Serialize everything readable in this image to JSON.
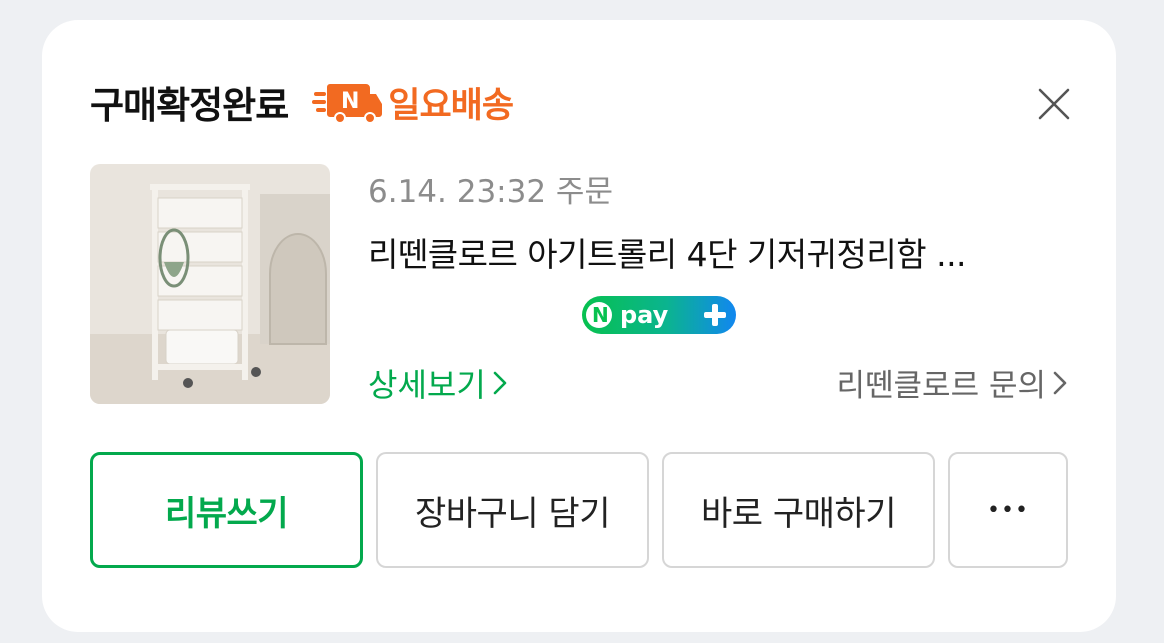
{
  "colors": {
    "accent_green": "#03a94d",
    "delivery_orange": "#f26a21"
  },
  "header": {
    "status": "구매확정완료",
    "badge_icon": "delivery-truck-N-icon",
    "delivery_label": "일요배송",
    "close_icon": "close-icon"
  },
  "order": {
    "date_text": "6.14. 23:32 주문",
    "product_name": "리뗀클로르 아기트롤리 4단 기저귀정리함 ...",
    "pay_badge": "npay+",
    "detail_link": "상세보기",
    "inquiry_link": "리뗀클로르 문의"
  },
  "actions": {
    "review": "리뷰쓰기",
    "cart": "장바구니 담기",
    "buy_now": "바로 구매하기",
    "more": "•••"
  }
}
